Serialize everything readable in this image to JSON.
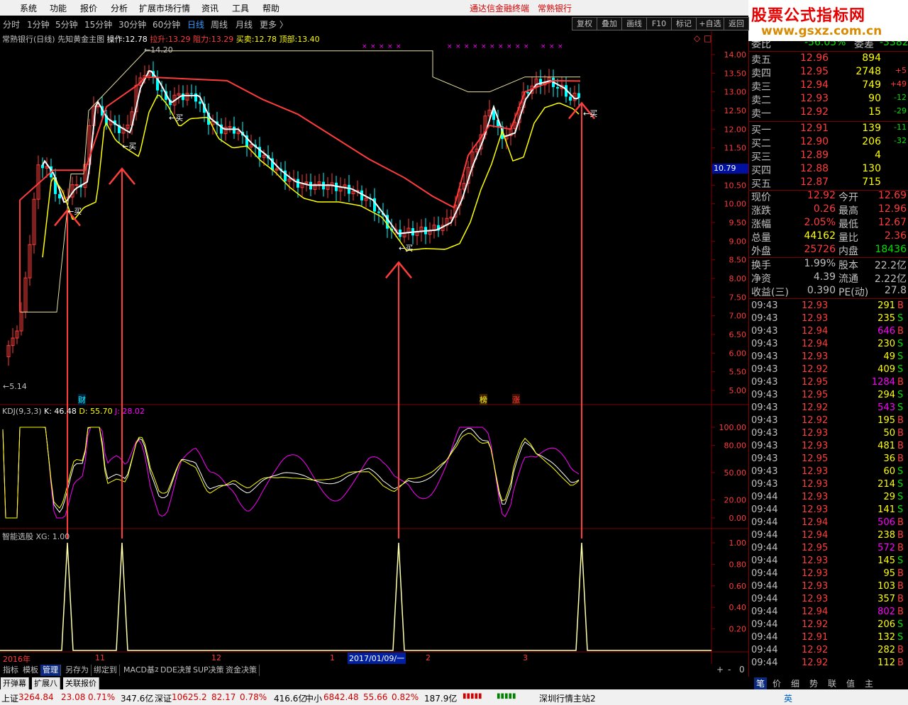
{
  "menu": {
    "items": [
      "系统",
      "功能",
      "报价",
      "分析",
      "扩展市场行情",
      "资讯",
      "工具",
      "帮助"
    ],
    "center1": "通达信金融终端",
    "center2": "常熟银行"
  },
  "logo": {
    "line1": "股票公式指标网",
    "line2": "www.gsxz.com.cn"
  },
  "periods": [
    "分时",
    "1分钟",
    "5分钟",
    "15分钟",
    "30分钟",
    "60分钟",
    "日线",
    "周线",
    "月线",
    "更多 〉"
  ],
  "active_period": "日线",
  "right_buttons": [
    "复权",
    "叠加",
    "画线",
    "F10",
    "标记",
    "+自选",
    "返回"
  ],
  "main_info": {
    "title": "常熟银行(日线) 先知黄金主图",
    "op_label": "操作:",
    "op_val": "12.78",
    "la_label": "拉升:",
    "la_val": "13.29",
    "zu_label": "阻力:",
    "zu_val": "13.29",
    "mm_label": "买卖:",
    "mm_val": "12.78",
    "top_label": "顶部:",
    "top_val": "13.40"
  },
  "price_axis": [
    "14.00",
    "13.50",
    "13.00",
    "12.50",
    "12.00",
    "11.50",
    "11.00",
    "10.50",
    "10.00",
    "9.50",
    "9.00",
    "8.50",
    "8.00",
    "7.50",
    "7.00",
    "6.50",
    "6.00",
    "5.50",
    "5.00"
  ],
  "cur_price_tag": "10.79",
  "hi_label": "14.20",
  "lo_label": "5.14",
  "buy_label": "买",
  "markers": {
    "cai": "财",
    "bang": "榜",
    "zhang": "涨"
  },
  "kdj": {
    "title": "KDJ(9,3,3)",
    "k": "K: 46.48",
    "d": "D: 55.70",
    "j": "J: 28.02",
    "axis": [
      "100.00",
      "80.00",
      "50.00",
      "20.00",
      "0.00"
    ]
  },
  "xg": {
    "title": "智能选股 XG: 1.00",
    "axis": [
      "1.00",
      "0.80",
      "0.60",
      "0.40",
      "0.20"
    ]
  },
  "dates": {
    "y2016": "2016年",
    "m11": "11",
    "m12": "12",
    "m1": "1",
    "cursor": "2017/01/09/一",
    "m2": "2",
    "m3": "3"
  },
  "zoom": [
    "+",
    "-",
    "0"
  ],
  "orderbook": {
    "header": {
      "l1": "委比",
      "v1": "-56.05%",
      "l2": "委差",
      "v2": "-3382"
    },
    "asks": [
      [
        "卖五",
        "12.96",
        "894",
        ""
      ],
      [
        "卖四",
        "12.95",
        "2748",
        "+5"
      ],
      [
        "卖三",
        "12.94",
        "749",
        "+49"
      ],
      [
        "卖二",
        "12.93",
        "90",
        "-12"
      ],
      [
        "卖一",
        "12.92",
        "15",
        "-29"
      ]
    ],
    "bids": [
      [
        "买一",
        "12.91",
        "139",
        "-11"
      ],
      [
        "买二",
        "12.90",
        "206",
        "-32"
      ],
      [
        "买三",
        "12.89",
        "4",
        ""
      ],
      [
        "买四",
        "12.88",
        "130",
        ""
      ],
      [
        "买五",
        "12.87",
        "715",
        ""
      ]
    ]
  },
  "quote": [
    [
      "现价",
      "12.92",
      "今开",
      "12.69"
    ],
    [
      "涨跌",
      "0.26",
      "最高",
      "12.96"
    ],
    [
      "涨幅",
      "2.05%",
      "最低",
      "12.67"
    ],
    [
      "总量",
      "44162",
      "量比",
      "2.36"
    ],
    [
      "外盘",
      "25726",
      "内盘",
      "18436"
    ]
  ],
  "fund": [
    [
      "换手",
      "1.99%",
      "股本",
      "22.2亿"
    ],
    [
      "净资",
      "4.39",
      "流通",
      "2.22亿"
    ],
    [
      "收益(三)",
      "0.390",
      "PE(动)",
      "27.8"
    ]
  ],
  "ticks": [
    [
      "09:43",
      "12.93",
      "291",
      "B"
    ],
    [
      "09:43",
      "12.93",
      "235",
      "S"
    ],
    [
      "09:43",
      "12.94",
      "646",
      "B"
    ],
    [
      "09:43",
      "12.94",
      "230",
      "S"
    ],
    [
      "09:43",
      "12.93",
      "49",
      "S"
    ],
    [
      "09:43",
      "12.92",
      "409",
      "S"
    ],
    [
      "09:43",
      "12.95",
      "1284",
      "B"
    ],
    [
      "09:43",
      "12.95",
      "294",
      "S"
    ],
    [
      "09:43",
      "12.92",
      "543",
      "S"
    ],
    [
      "09:43",
      "12.92",
      "195",
      "B"
    ],
    [
      "09:43",
      "12.93",
      "50",
      "B"
    ],
    [
      "09:43",
      "12.93",
      "481",
      "B"
    ],
    [
      "09:43",
      "12.95",
      "36",
      "B"
    ],
    [
      "09:43",
      "12.93",
      "60",
      "S"
    ],
    [
      "09:43",
      "12.93",
      "214",
      "S"
    ],
    [
      "09:44",
      "12.93",
      "29",
      "S"
    ],
    [
      "09:44",
      "12.93",
      "141",
      "S"
    ],
    [
      "09:44",
      "12.94",
      "506",
      "B"
    ],
    [
      "09:44",
      "12.94",
      "238",
      "B"
    ],
    [
      "09:44",
      "12.95",
      "572",
      "B"
    ],
    [
      "09:44",
      "12.93",
      "145",
      "S"
    ],
    [
      "09:44",
      "12.93",
      "95",
      "B"
    ],
    [
      "09:44",
      "12.93",
      "103",
      "B"
    ],
    [
      "09:44",
      "12.93",
      "357",
      "B"
    ],
    [
      "09:44",
      "12.94",
      "802",
      "B"
    ],
    [
      "09:44",
      "12.92",
      "206",
      "S"
    ],
    [
      "09:44",
      "12.91",
      "132",
      "S"
    ],
    [
      "09:44",
      "12.92",
      "282",
      "B"
    ],
    [
      "09:44",
      "12.92",
      "112",
      "B"
    ]
  ],
  "panel_tabs": [
    "笔",
    "价",
    "细",
    "势",
    "联",
    "值",
    "主"
  ],
  "bottom_tabs": [
    "指标",
    "模板",
    "管理",
    "另存为",
    "绑定到",
    "MACD基本",
    "DDE决策",
    "SUP决策",
    "资金决策"
  ],
  "bottom_active": "管理",
  "bottom_tabs2": [
    "开弹幕",
    "扩展八",
    "关联报价"
  ],
  "status": {
    "sh_l": "上证",
    "sh_v": "3264.84",
    "sh_c": "23.08",
    "sh_p": "0.71%",
    "sh_a": "347.6亿",
    "sz_l": "深证",
    "sz_v": "10625.2",
    "sz_c": "82.17",
    "sz_p": "0.78%",
    "sz_a": "416.6亿",
    "zx_l": "中小",
    "zx_v": "6842.48",
    "zx_c": "55.66",
    "zx_p": "0.82%",
    "zx_a": "187.9亿",
    "server": "深圳行情主站2",
    "ime": "英"
  },
  "colors": {
    "red": "#ff3c3c",
    "green": "#00e000",
    "yellow": "#ffff00",
    "magenta": "#ff00ff",
    "cyan": "#00ffff",
    "white": "#ffffff",
    "grey": "#c0c0c0",
    "frame": "#800000"
  }
}
